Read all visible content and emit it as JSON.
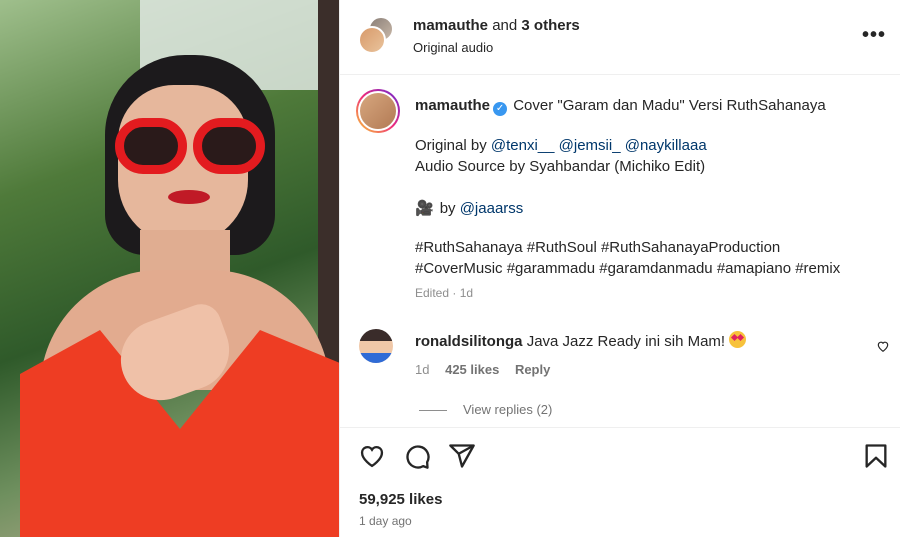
{
  "header": {
    "user": "mamauthe",
    "and_text": "and",
    "others": "3 others",
    "subtitle": "Original audio",
    "more_label": "•••"
  },
  "caption": {
    "user": "mamauthe",
    "text": "Cover \"Garam dan Madu\" Versi RuthSahanaya",
    "original_by_prefix": "Original by",
    "original_mentions": [
      "@tenxi__",
      "@jemsii_",
      "@naykillaaa"
    ],
    "audio_source": "Audio Source by Syahbandar (Michiko Edit)",
    "by_prefix": "by",
    "by_mention": "@jaaarss",
    "hashtags_line1": "#RuthSahanaya #RuthSoul #RuthSahanayaProduction",
    "hashtags_line2": "#CoverMusic #garammadu #garamdanmadu #amapiano #remix",
    "meta": "Edited · 1d"
  },
  "comment": {
    "user": "ronaldsilitonga",
    "text": "Java Jazz Ready ini sih Mam!",
    "age": "1d",
    "likes": "425 likes",
    "reply_label": "Reply",
    "view_replies": "View replies (2)"
  },
  "post": {
    "likes": "59,925 likes",
    "time_ago": "1 day ago"
  },
  "colors": {
    "link": "#00376b",
    "verified": "#3897f0",
    "muted": "#8e8e8e"
  },
  "icons": [
    "heart-icon",
    "comment-icon",
    "share-icon",
    "bookmark-icon",
    "more-icon",
    "verified-icon",
    "camera-icon"
  ]
}
